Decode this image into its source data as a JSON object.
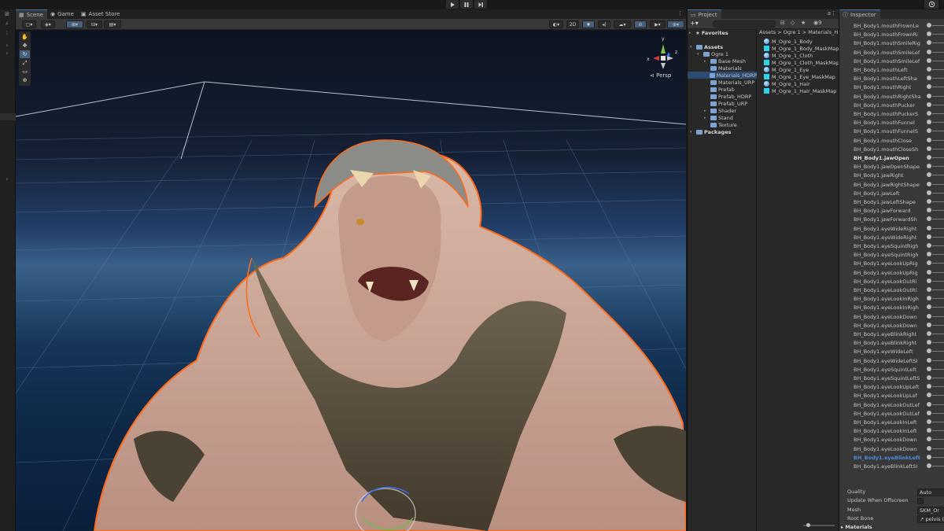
{
  "toolbar": {
    "play_icon": "play-icon",
    "pause_icon": "pause-icon",
    "step_icon": "step-icon",
    "history_icon": "history-icon"
  },
  "scene_tabs": [
    {
      "label": "Scene",
      "icon": "grid-icon"
    },
    {
      "label": "Game",
      "icon": "gamepad-icon"
    },
    {
      "label": "Asset Store",
      "icon": "store-icon"
    }
  ],
  "scene_toolbar": {
    "mode_2d": "2D"
  },
  "scene_view": {
    "projection": "Persp",
    "gizmo_axes": {
      "y": "y",
      "x": "x",
      "z": "z"
    },
    "sky_colors": [
      "#0d1320",
      "#3a6189",
      "#0a1f3c"
    ],
    "selection_outline": "#ff6a1a"
  },
  "tools": [
    "hand-icon",
    "move-icon",
    "rotate-icon",
    "scale-icon",
    "rect-icon",
    "transform-icon"
  ],
  "project": {
    "tab": "Project",
    "badge": "9",
    "favorites": "Favorites",
    "tree": [
      {
        "label": "Assets",
        "level": 0,
        "bold": true
      },
      {
        "label": "Ogre 1",
        "level": 1
      },
      {
        "label": "Base Mesh",
        "level": 2
      },
      {
        "label": "Materials",
        "level": 2
      },
      {
        "label": "Materials_HDRP",
        "level": 2,
        "selected": true
      },
      {
        "label": "Materials_URP",
        "level": 2
      },
      {
        "label": "Prefab",
        "level": 2
      },
      {
        "label": "Prefab_HDRP",
        "level": 2
      },
      {
        "label": "Prefab_URP",
        "level": 2
      },
      {
        "label": "Shader",
        "level": 2
      },
      {
        "label": "Stand",
        "level": 2
      },
      {
        "label": "Texture",
        "level": 2
      },
      {
        "label": "Packages",
        "level": 0,
        "bold": true
      }
    ],
    "breadcrumb": "Assets > Ogre 1 > Materials_H",
    "files": [
      {
        "name": "M_Ogre_1_Body",
        "kind": "material"
      },
      {
        "name": "M_Ogre_1_Body_MaskMap",
        "kind": "texture"
      },
      {
        "name": "M_Ogre_1_Cloth",
        "kind": "material"
      },
      {
        "name": "M_Ogre_1_Cloth_MaskMap",
        "kind": "texture"
      },
      {
        "name": "M_Ogre_1_Eye",
        "kind": "material"
      },
      {
        "name": "M_Ogre_1_Eye_MaskMap",
        "kind": "texture"
      },
      {
        "name": "M_Ogre_1_Hair",
        "kind": "material"
      },
      {
        "name": "M_Ogre_1_Hair_MaskMap",
        "kind": "texture"
      }
    ]
  },
  "inspector": {
    "tab": "Inspector",
    "blendshapes": [
      {
        "name": "BH_Body1.mouthFrownLe"
      },
      {
        "name": "BH_Body1.mouthFrownRi"
      },
      {
        "name": "BH_Body1.mouthSmileRig"
      },
      {
        "name": "BH_Body1.mouthSmileLef"
      },
      {
        "name": "BH_Body1.mouthSmileLef"
      },
      {
        "name": "BH_Body1.mouthLeft"
      },
      {
        "name": "BH_Body1.mouthLeftSha"
      },
      {
        "name": "BH_Body1.mouthRight"
      },
      {
        "name": "BH_Body1.mouthRightSha"
      },
      {
        "name": "BH_Body1.mouthPucker"
      },
      {
        "name": "BH_Body1.mouthPuckerS"
      },
      {
        "name": "BH_Body1.mouthFunnel"
      },
      {
        "name": "BH_Body1.mouthFunnelS"
      },
      {
        "name": "BH_Body1.mouthClose"
      },
      {
        "name": "BH_Body1.mouthCloseSh"
      },
      {
        "name": "BH_Body1.jawOpen",
        "style": "bold"
      },
      {
        "name": "BH_Body1.jawOpenShape"
      },
      {
        "name": "BH_Body1.jawRight"
      },
      {
        "name": "BH_Body1.jawRightShape"
      },
      {
        "name": "BH_Body1.jawLeft"
      },
      {
        "name": "BH_Body1.jawLeftShape"
      },
      {
        "name": "BH_Body1.jawForward"
      },
      {
        "name": "BH_Body1.jawForwardSh"
      },
      {
        "name": "BH_Body1.eyeWideRight"
      },
      {
        "name": "BH_Body1.eyeWideRight"
      },
      {
        "name": "BH_Body1.eyeSquintRigh"
      },
      {
        "name": "BH_Body1.eyeSquintRigh"
      },
      {
        "name": "BH_Body1.eyeLookUpRig"
      },
      {
        "name": "BH_Body1.eyeLookUpRig"
      },
      {
        "name": "BH_Body1.eyeLookOutRi"
      },
      {
        "name": "BH_Body1.eyeLookOutRi"
      },
      {
        "name": "BH_Body1.eyeLookInRigh"
      },
      {
        "name": "BH_Body1.eyeLookInRigh"
      },
      {
        "name": "BH_Body1.eyeLookDown"
      },
      {
        "name": "BH_Body1.eyeLookDown"
      },
      {
        "name": "BH_Body1.eyeBlinkRight"
      },
      {
        "name": "BH_Body1.eyeBlinkRight"
      },
      {
        "name": "BH_Body1.eyeWideLeft"
      },
      {
        "name": "BH_Body1.eyeWideLeftSI"
      },
      {
        "name": "BH_Body1.eyeSquintLeft"
      },
      {
        "name": "BH_Body1.eyeSquintLeftS"
      },
      {
        "name": "BH_Body1.eyeLookUpLeft"
      },
      {
        "name": "BH_Body1.eyeLookUpLef"
      },
      {
        "name": "BH_Body1.eyeLookOutLef"
      },
      {
        "name": "BH_Body1.eyeLookOutLef"
      },
      {
        "name": "BH_Body1.eyeLookInLeft"
      },
      {
        "name": "BH_Body1.eyeLookInLeft"
      },
      {
        "name": "BH_Body1.eyeLookDown"
      },
      {
        "name": "BH_Body1.eyeLookDown"
      },
      {
        "name": "BH_Body1.eyeBlinkLeft",
        "style": "highlight"
      },
      {
        "name": "BH_Body1.eyeBlinkLeftSI"
      }
    ],
    "properties": [
      {
        "label": "Quality",
        "value": "Auto"
      },
      {
        "label": "Update When Offscreen",
        "value": ""
      },
      {
        "label": "Mesh",
        "value": "SKM_Or"
      },
      {
        "label": "Root Bone",
        "value": "↗ pelvis (T"
      }
    ],
    "section": "Materials",
    "accent": "#4e8bd8"
  }
}
